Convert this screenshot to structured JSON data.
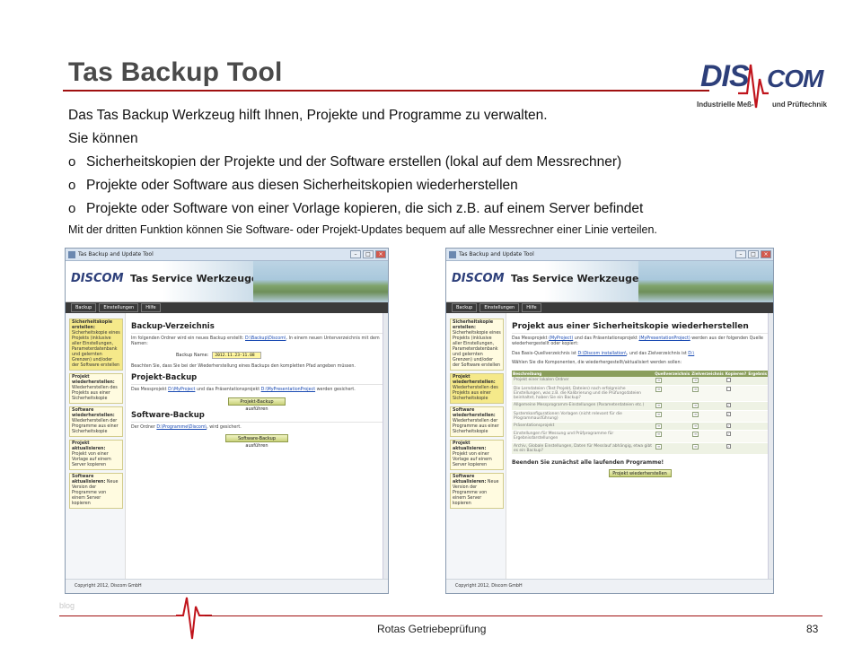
{
  "slide": {
    "title": "Tas Backup Tool",
    "intro": "Das Tas Backup Werkzeug hilft Ihnen, Projekte und Programme zu verwalten.",
    "sub": "Sie können",
    "bullet_marker": "o",
    "bullets": [
      "Sicherheitskopien der Projekte und der Software erstellen (lokal auf dem Messrechner)",
      "Projekte oder Software aus diesen Sicherheitskopien wiederherstellen",
      "Projekte oder Software von einer Vorlage kopieren, die sich z.B. auf einem Server befindet"
    ],
    "note": "Mit der dritten Funktion können Sie Software- oder Projekt-Updates bequem auf alle Messrechner einer Linie verteilen."
  },
  "logo": {
    "part1": "DIS",
    "part2": "COM",
    "tagline1": "Industrielle Meß-",
    "tagline2": "und Prüftechnik"
  },
  "shot_left": {
    "window_title": "Tas Backup and Update Tool",
    "app_logo": "DISCOM",
    "app_title": "Tas Service Werkzeuge",
    "menu": [
      "Backup",
      "Einstellungen",
      "Hilfe"
    ],
    "sidebar": [
      {
        "title": "Sicherheitskopie erstellen:",
        "text": "Sicherheitskopie eines Projekts (inklusive aller Einstellungen, Parameterdatenbank und gelernten Grenzen) und/oder der Software erstellen"
      },
      {
        "title": "Projekt wiederherstellen:",
        "text": "Wiederherstellen des Projekts aus einer Sicherheitskopie"
      },
      {
        "title": "Software wiederherstellen:",
        "text": "Wiederherstellen der Programme aus einer Sicherheitskopie"
      },
      {
        "title": "Projekt aktualisieren:",
        "text": "Projekt von einer Vorlage auf einem Server kopieren"
      },
      {
        "title": "Software aktualisieren:",
        "text": "Neue Version der Programme von einem Server kopieren"
      }
    ],
    "backup_dir_title": "Backup-Verzeichnis",
    "backup_dir_text1": "Im folgenden Ordner wird ein neues Backup erstellt:",
    "backup_dir_link": "D:\\Backup\\Discom\\",
    "backup_dir_text2": ". In einem neuen Unterverzeichnis mit dem Namen:",
    "field_label": "Backup Name:",
    "field_value": "2012.11.23-11.08",
    "backup_note": "Beachten Sie, dass Sie bei der Wiederherstellung eines Backups den kompletten Pfad angeben müssen.",
    "project_title": "Projekt-Backup",
    "project_text1": "Das Messprojekt",
    "project_link1": "D:\\MyProject",
    "project_text2": "und das Präsentationsprojekt",
    "project_link2": "D:\\MyPresentationProject",
    "project_text3": "werden gesichert.",
    "project_button": "Projekt-Backup ausführen",
    "software_title": "Software-Backup",
    "software_text1": "Der Ordner",
    "software_link": "D:\\Programme\\Discom\\",
    "software_text2": ", wird gesichert.",
    "software_button": "Software-Backup ausführen",
    "copyright": "Copyright 2012, Discom GmbH"
  },
  "shot_right": {
    "window_title": "Tas Backup and Update Tool",
    "app_logo": "DISCOM",
    "app_title": "Tas Service Werkzeuge",
    "menu": [
      "Backup",
      "Einstellungen",
      "Hilfe"
    ],
    "section_title": "Projekt aus einer Sicherheitskopie wiederherstellen",
    "text1a": "Das Messprojekt",
    "text1_link1": "(MyProject)",
    "text1b": "und das Präsentationsprojekt",
    "text1_link2": "(MyPresentationProject)",
    "text1c": "werden aus der folgenden Quelle wiederhergestellt oder kopiert:",
    "text2a": "Das Basis-Quellverzeichnis ist",
    "text2_link": "D:\\Discom installation\\",
    "text2b": ", und das Zielverzeichnis ist",
    "text2_link2": "D:\\",
    "text3": "Wählen Sie die Komponenten, die wiederhergestellt/aktualisiert werden sollen:",
    "table_headers": [
      "Beschreibung",
      "Quellverzeichnis",
      "Zielverzeichnis",
      "Kopieren?",
      "Ergebnis"
    ],
    "table_rows": [
      {
        "desc": "Projekt einer lokalen Ordner",
        "copy": ""
      },
      {
        "desc": "Die Lerndateien (Test Projekt, Dateien) nach erfolgreiche Einstellungen, was z.B. die Kalibrierung und die Prüfungsdateien beinhaltet, haben Sie ein Backup?",
        "copy": ""
      },
      {
        "desc": "Allgemeine Messprogramm-Einstellungen (Parameterdateien etc.)",
        "copy": "✓"
      },
      {
        "desc": "Systemkonfigurationen Vorlagen (nicht relevant für die Programmausführung)",
        "copy": "✓"
      },
      {
        "desc": "Präsentationsprojekt",
        "copy": "✓"
      },
      {
        "desc": "Einstellungen für Messung und Prüfprogramme für Ergebnisdarstellungen",
        "copy": "✓"
      },
      {
        "desc": "Archiv, Globale Einstellungen, Daten für Messlauf abhängig, etwa gibt es ein Backup?",
        "copy": "✓"
      }
    ],
    "warning": "Beenden Sie zunächst alle laufenden Programme!",
    "restore_button": "Projekt wiederherstellen",
    "copyright": "Copyright 2012, Discom GmbH"
  },
  "footer": {
    "blog": "blog",
    "center": "Rotas Getriebeprüfung",
    "page": "83"
  }
}
